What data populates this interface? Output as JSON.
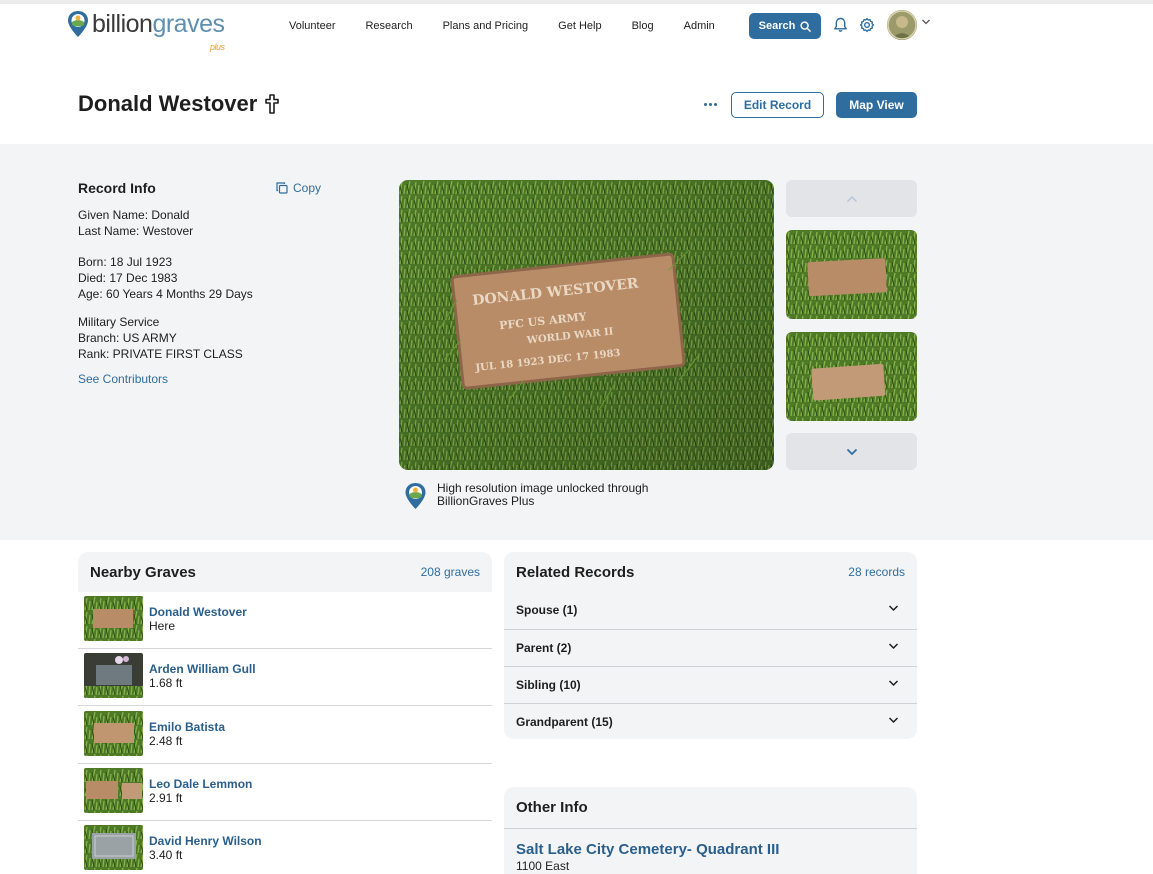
{
  "brand": {
    "name_part1": "billion",
    "name_part2": "graves",
    "plus": "plus",
    "accent": "#2f6d9e",
    "plus_color": "#e6a33a"
  },
  "nav": {
    "items": [
      {
        "label": "Volunteer"
      },
      {
        "label": "Research"
      },
      {
        "label": "Plans and Pricing"
      },
      {
        "label": "Get Help"
      },
      {
        "label": "Blog"
      },
      {
        "label": "Admin"
      }
    ],
    "search_label": "Search"
  },
  "record": {
    "name": "Donald Westover",
    "edit_label": "Edit Record",
    "map_label": "Map View"
  },
  "record_info": {
    "title": "Record Info",
    "copy_label": "Copy",
    "given_name": "Given Name: Donald",
    "last_name": "Last Name: Westover",
    "born": "Born: 18 Jul 1923",
    "died": "Died: 17 Dec 1983",
    "age": "Age: 60 Years 4 Months 29 Days",
    "military": "Military Service",
    "branch": "Branch: US ARMY",
    "rank": "Rank: PRIVATE FIRST CLASS",
    "contributors_link": "See Contributors"
  },
  "headstone": {
    "line1": "DONALD  WESTOVER",
    "line2": "PFC    US ARMY",
    "line3": "WORLD WAR II",
    "line4": "JUL 18 1923   DEC 17 1983"
  },
  "plus_note": {
    "line1": "High resolution image unlocked through",
    "line2": "BillionGraves Plus"
  },
  "nearby": {
    "title": "Nearby Graves",
    "count": "208 graves",
    "rows": [
      {
        "name": "Donald Westover",
        "dist": "Here"
      },
      {
        "name": "Arden William Gull",
        "dist": "1.68 ft"
      },
      {
        "name": "Emilo Batista",
        "dist": "2.48 ft"
      },
      {
        "name": "Leo Dale Lemmon",
        "dist": "2.91 ft"
      },
      {
        "name": "David Henry Wilson",
        "dist": "3.40 ft"
      }
    ]
  },
  "related": {
    "title": "Related Records",
    "count": "28 records",
    "rows": [
      {
        "label": "Spouse (1)"
      },
      {
        "label": "Parent (2)"
      },
      {
        "label": "Sibling (10)"
      },
      {
        "label": "Grandparent (15)"
      }
    ]
  },
  "other_info": {
    "title": "Other Info",
    "cemetery": "Salt Lake City Cemetery- Quadrant III",
    "address": "1100 East"
  }
}
